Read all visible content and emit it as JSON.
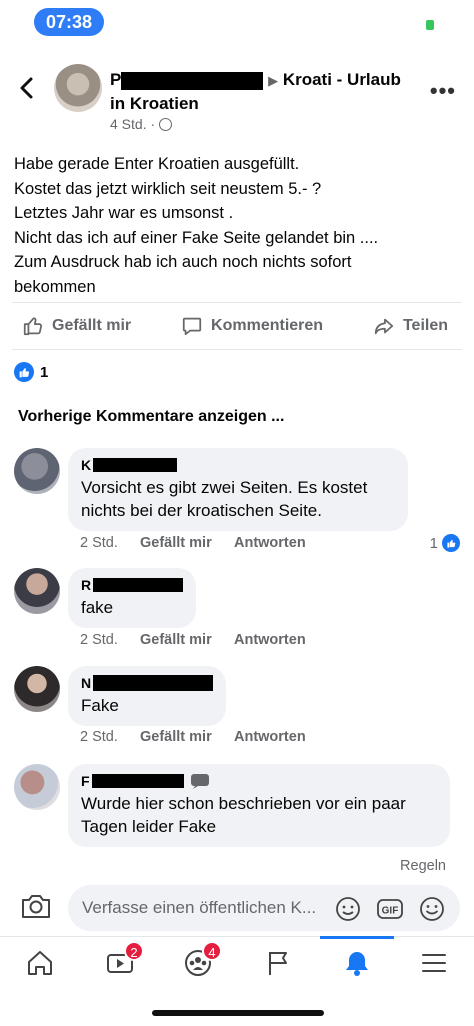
{
  "status": {
    "time": "07:38"
  },
  "header": {
    "author_initial": "P",
    "group_name": "Kroati - Urlaub",
    "group_name_line2": "in Kroatien",
    "time": "4 Std. ·"
  },
  "post": {
    "text": "Habe gerade Enter Kroatien ausgefüllt.\nKostet das  jetzt wirklich seit neustem 5.- ?\nLetztes Jahr war es umsonst .\nNicht das ich auf einer Fake Seite gelandet bin ....\nZum Ausdruck hab ich auch noch nichts sofort\nbekommen"
  },
  "actions": {
    "like": "Gefällt mir",
    "comment": "Kommentieren",
    "share": "Teilen"
  },
  "reactions": {
    "count": "1"
  },
  "prev_comments_label": "Vorherige Kommentare anzeigen ...",
  "comments": [
    {
      "initial": "K",
      "text": "Vorsicht es gibt zwei Seiten. Es kostet\nnichts bei der kroatischen Seite.",
      "time": "2 Std.",
      "like": "Gefällt mir",
      "reply": "Antworten",
      "reaction_count": "1"
    },
    {
      "initial": "R",
      "text": "fake",
      "time": "2 Std.",
      "like": "Gefällt mir",
      "reply": "Antworten"
    },
    {
      "initial": "N",
      "text": "Fake",
      "time": "2 Std.",
      "like": "Gefällt mir",
      "reply": "Antworten"
    },
    {
      "initial": "F",
      "text": "Wurde hier schon beschrieben vor ein paar\nTagen leider Fake"
    }
  ],
  "rules_label": "Regeln",
  "composer": {
    "placeholder": "Verfasse einen öffentlichen K..."
  },
  "tabs": {
    "video_badge": "2",
    "groups_badge": "4"
  },
  "colors": {
    "accent": "#1877f2",
    "badge": "#e41e3f",
    "bubble": "#f0f2f5",
    "status_pill": "#2f7df6"
  }
}
